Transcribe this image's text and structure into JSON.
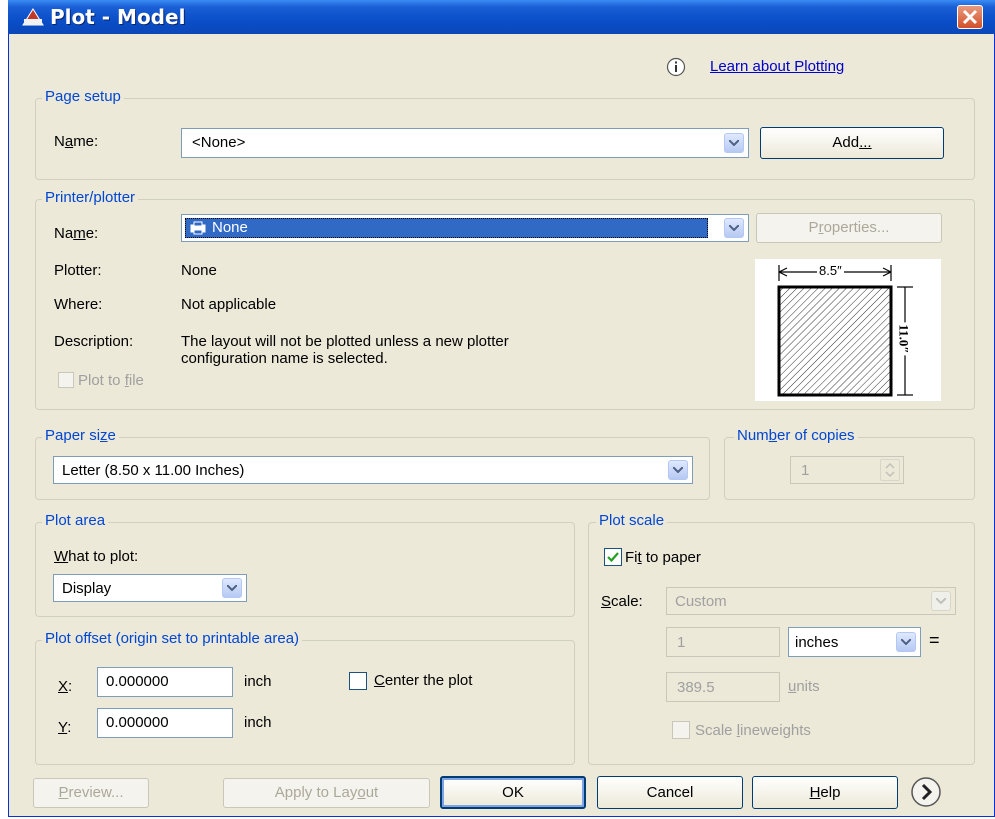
{
  "window": {
    "title": "Plot - Model"
  },
  "learn_link": "Learn about Plotting",
  "page_setup": {
    "legend": "Page setup",
    "name_label_pre": "N",
    "name_label_ul": "a",
    "name_label_post": "me:",
    "name_value": "<None>",
    "add_pre": "Add",
    "add_ul": "...",
    "add_post": ""
  },
  "printer": {
    "legend": "Printer/plotter",
    "name_label_pre": "Na",
    "name_label_ul": "m",
    "name_label_post": "e:",
    "name_value": "None",
    "properties_pre": "P",
    "properties_ul": "r",
    "properties_post": "operties...",
    "plotter_label": "Plotter:",
    "plotter_value": "None",
    "where_label": "Where:",
    "where_value": "Not applicable",
    "description_label": "Description:",
    "description_line1": "The layout will not be plotted unless a new plotter",
    "description_line2": "configuration name is selected.",
    "plot_to_file_pre": "Plot to ",
    "plot_to_file_ul": "f",
    "plot_to_file_post": "ile",
    "preview_width": "8.5″",
    "preview_height": "11.0″"
  },
  "paper_size": {
    "legend_pre": "Paper si",
    "legend_ul": "z",
    "legend_post": "e",
    "value": "Letter (8.50 x 11.00 Inches)"
  },
  "copies": {
    "legend_pre": "Num",
    "legend_ul": "b",
    "legend_post": "er of copies",
    "value": "1"
  },
  "plot_area": {
    "legend": "Plot area",
    "what_label_pre": "",
    "what_label_ul": "W",
    "what_label_post": "hat to plot:",
    "value": "Display"
  },
  "plot_offset": {
    "legend": "Plot offset (origin set to printable area)",
    "x_label": "X",
    "x_value": "0.000000",
    "x_unit": "inch",
    "y_label": "Y",
    "y_value": "0.000000",
    "y_unit": "inch",
    "center_pre": "",
    "center_ul": "C",
    "center_post": "enter the plot"
  },
  "plot_scale": {
    "legend": "Plot scale",
    "fit_pre": "Fi",
    "fit_ul": "t",
    "fit_post": " to paper",
    "fit_checked": true,
    "scale_label_ul": "S",
    "scale_label_post": "cale:",
    "scale_value": "Custom",
    "value1": "1",
    "unit_value": "inches",
    "equals": "=",
    "value2": "389.5",
    "units_pre": "",
    "units_ul": "u",
    "units_post": "nits",
    "lineweights_pre": "Scale ",
    "lineweights_ul": "l",
    "lineweights_post": "ineweights"
  },
  "buttons": {
    "preview_pre": "",
    "preview_ul": "P",
    "preview_post": "review...",
    "apply_pre": "Apply to Lay",
    "apply_ul": "o",
    "apply_post": "ut",
    "ok": "OK",
    "cancel": "Cancel",
    "help_pre": "",
    "help_ul": "H",
    "help_post": "elp"
  }
}
